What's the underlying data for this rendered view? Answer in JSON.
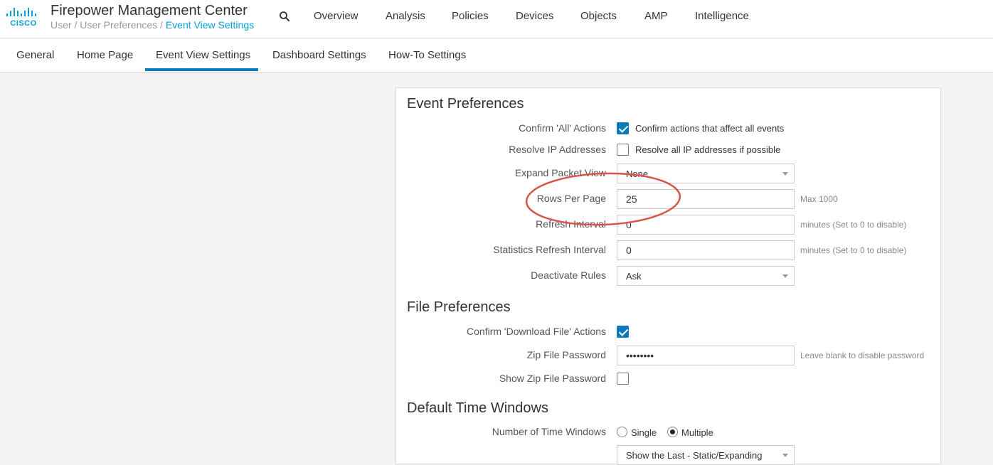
{
  "app": {
    "logo_text": "CISCO",
    "title": "Firepower Management Center",
    "breadcrumb": {
      "part1": "User",
      "sep1": " / ",
      "part2": "User Preferences",
      "sep2": " / ",
      "current": "Event View Settings"
    }
  },
  "nav": [
    "Overview",
    "Analysis",
    "Policies",
    "Devices",
    "Objects",
    "AMP",
    "Intelligence"
  ],
  "subtabs": {
    "items": [
      "General",
      "Home Page",
      "Event View Settings",
      "Dashboard Settings",
      "How-To Settings"
    ],
    "active": "Event View Settings"
  },
  "event_prefs": {
    "title": "Event Preferences",
    "confirm_all": {
      "label": "Confirm 'All' Actions",
      "checkbox_text": "Confirm actions that affect all events",
      "checked": true
    },
    "resolve_ip": {
      "label": "Resolve IP Addresses",
      "checkbox_text": "Resolve all IP addresses if possible",
      "checked": false
    },
    "expand_packet": {
      "label": "Expand Packet View",
      "value": "None"
    },
    "rows_per_page": {
      "label": "Rows Per Page",
      "value": "25",
      "hint": "Max 1000"
    },
    "refresh_interval": {
      "label": "Refresh Interval",
      "value": "0",
      "hint": "minutes (Set to 0 to disable)"
    },
    "stats_refresh": {
      "label": "Statistics Refresh Interval",
      "value": "0",
      "hint": "minutes (Set to 0 to disable)"
    },
    "deactivate_rules": {
      "label": "Deactivate Rules",
      "value": "Ask"
    }
  },
  "file_prefs": {
    "title": "File Preferences",
    "confirm_download": {
      "label": "Confirm 'Download File' Actions",
      "checked": true
    },
    "zip_password": {
      "label": "Zip File Password",
      "value": "••••••••",
      "hint": "Leave blank to disable password"
    },
    "show_zip_password": {
      "label": "Show Zip File Password",
      "checked": false
    }
  },
  "time_windows": {
    "title": "Default Time Windows",
    "number": {
      "label": "Number of Time Windows",
      "option_single": "Single",
      "option_multiple": "Multiple",
      "selected": "Multiple"
    },
    "mode_select": {
      "value": "Show the Last - Static/Expanding"
    }
  },
  "colors": {
    "brand": "#049fd9",
    "accent": "#0d7bb8",
    "annotation": "#d9534f"
  }
}
